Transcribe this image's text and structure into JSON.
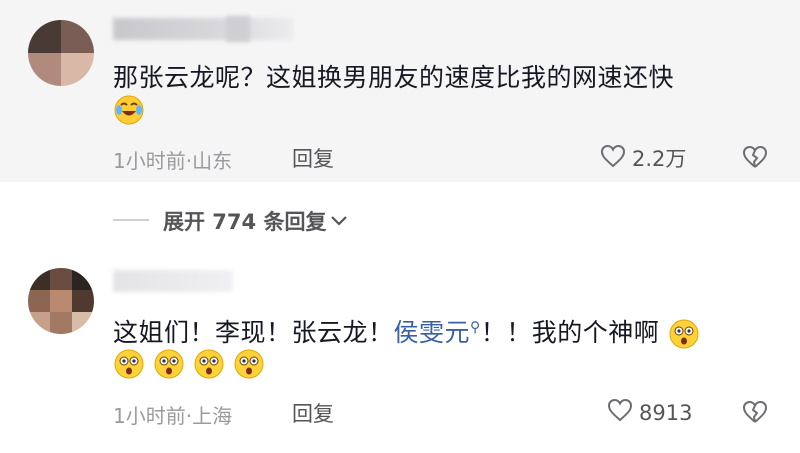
{
  "comments": [
    {
      "username": "...",
      "text": "那张云龙呢？这姐换男朋友的速度比我的网速还快",
      "emoji": [
        "crying-laughing-emoji"
      ],
      "time": "1小时前",
      "location": "山东",
      "reply_label": "回复",
      "likes": "2.2万"
    },
    {
      "username": "...",
      "text_parts": [
        "这姐们！李现！张云龙！",
        "侯雯元",
        "！！我的个神啊"
      ],
      "mention_icon": "search-icon",
      "emoji": [
        "surprised-emoji",
        "surprised-emoji",
        "surprised-emoji",
        "surprised-emoji",
        "surprised-emoji"
      ],
      "time": "1小时前",
      "location": "上海",
      "reply_label": "回复",
      "likes": "8913"
    }
  ],
  "expand_replies": {
    "label": "展开 774 条回复",
    "icon": "chevron-down-icon"
  },
  "icons": {
    "like": "heart-icon",
    "dislike": "broken-heart-icon"
  },
  "colors": {
    "text": "#161823",
    "meta": "#9a9aa0",
    "mention": "#3a5fa8",
    "band": "#f5f5f5"
  }
}
